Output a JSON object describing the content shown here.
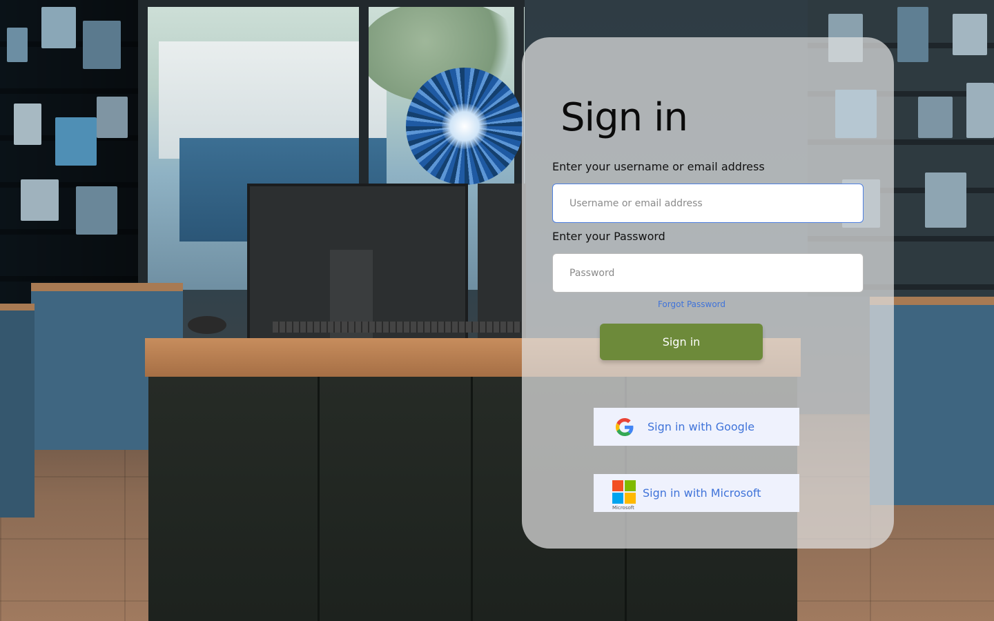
{
  "signin": {
    "title": "Sign in",
    "username_label": "Enter your username or email address",
    "username_placeholder": "Username or email address",
    "username_value": "",
    "password_label": "Enter your Password",
    "password_placeholder": "Password",
    "password_value": "",
    "forgot_password": "Forgot Password",
    "submit_label": "Sign in"
  },
  "sso": {
    "google_label": "Sign in with Google",
    "google_icon": "google-g-icon",
    "microsoft_label": "Sign in with Microsoft",
    "microsoft_icon": "microsoft-logo",
    "microsoft_wordmark": "Microsoft"
  },
  "colors": {
    "submit_button": "#6d8a3a",
    "link": "#3f73d9",
    "sso_background": "#eff2fd",
    "focused_input_border": "#4d7fe0"
  },
  "background": {
    "scene": "store-interior-photo"
  }
}
